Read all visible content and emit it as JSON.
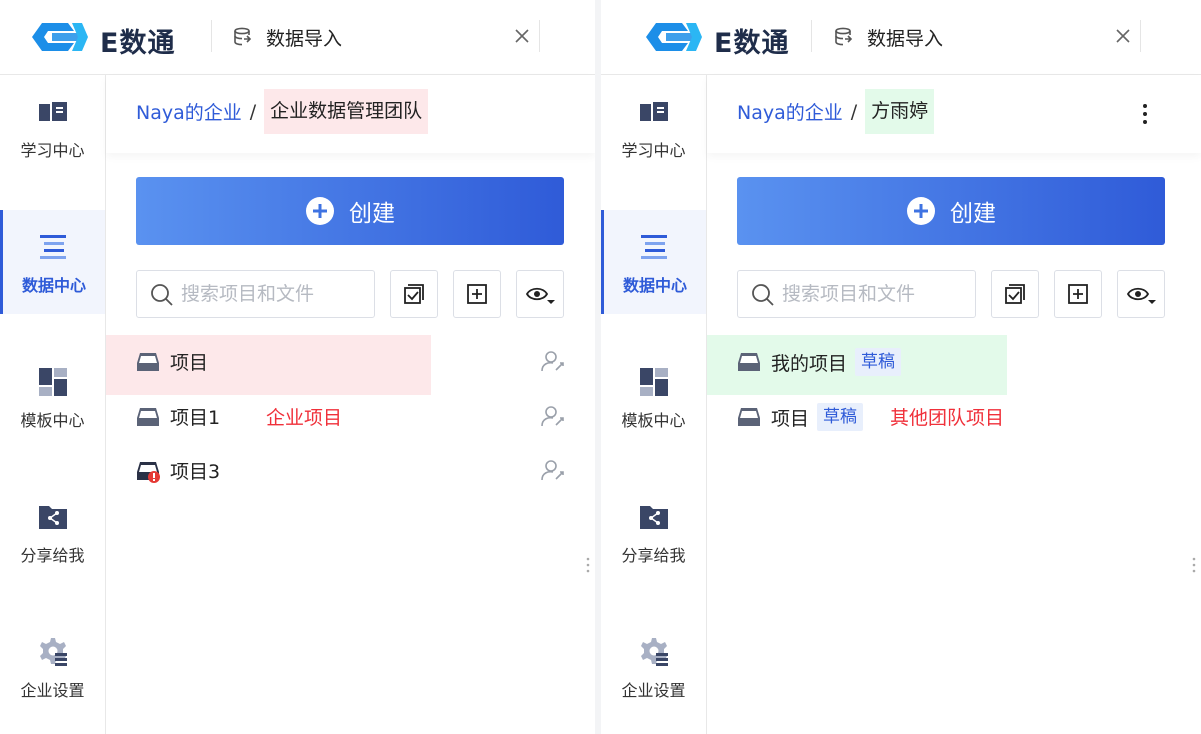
{
  "left_panel": {
    "app": {
      "logo_text": "E数通"
    },
    "tab": {
      "label": "数据导入"
    },
    "sidebar": {
      "items": [
        {
          "label": "学习中心",
          "icon": "book-icon",
          "active": false
        },
        {
          "label": "数据中心",
          "icon": "data-list-icon",
          "active": true
        },
        {
          "label": "模板中心",
          "icon": "template-grid-icon",
          "active": false
        },
        {
          "label": "分享给我",
          "icon": "shared-folder-icon",
          "active": false
        },
        {
          "label": "企业设置",
          "icon": "gear-icon",
          "active": false
        }
      ]
    },
    "breadcrumb": {
      "root": "Naya的企业",
      "separator": "/",
      "current": "企业数据管理团队"
    },
    "create_button": {
      "label": "创建"
    },
    "search": {
      "placeholder": "搜索项目和文件",
      "value": ""
    },
    "projects": [
      {
        "name": "项目",
        "highlight": true,
        "icon": "project-box-icon"
      },
      {
        "name": "项目1",
        "highlight": false,
        "icon": "project-box-icon"
      },
      {
        "name": "项目3",
        "highlight": false,
        "icon": "project-box-error-icon"
      }
    ],
    "annotation": "企业项目"
  },
  "right_panel": {
    "app": {
      "logo_text": "E数通"
    },
    "tab": {
      "label": "数据导入"
    },
    "sidebar": {
      "items": [
        {
          "label": "学习中心",
          "icon": "book-icon",
          "active": false
        },
        {
          "label": "数据中心",
          "icon": "data-list-icon",
          "active": true
        },
        {
          "label": "模板中心",
          "icon": "template-grid-icon",
          "active": false
        },
        {
          "label": "分享给我",
          "icon": "shared-folder-icon",
          "active": false
        },
        {
          "label": "企业设置",
          "icon": "gear-icon",
          "active": false
        }
      ]
    },
    "breadcrumb": {
      "root": "Naya的企业",
      "separator": "/",
      "current": "方雨婷"
    },
    "create_button": {
      "label": "创建"
    },
    "search": {
      "placeholder": "搜索项目和文件",
      "value": ""
    },
    "projects": [
      {
        "name": "我的项目",
        "badge": "草稿",
        "highlight": true,
        "icon": "project-box-icon"
      },
      {
        "name": "项目",
        "badge": "草稿",
        "highlight": false,
        "icon": "project-box-icon"
      }
    ],
    "annotation": "其他团队项目"
  },
  "colors": {
    "accent": "#2f5bd8",
    "gradient_start": "#5a92f0",
    "highlight_pink": "#fde8ea",
    "highlight_green": "#e3faea",
    "annotation_red": "#f0303a",
    "logo_blue": "#1c8ee8"
  }
}
